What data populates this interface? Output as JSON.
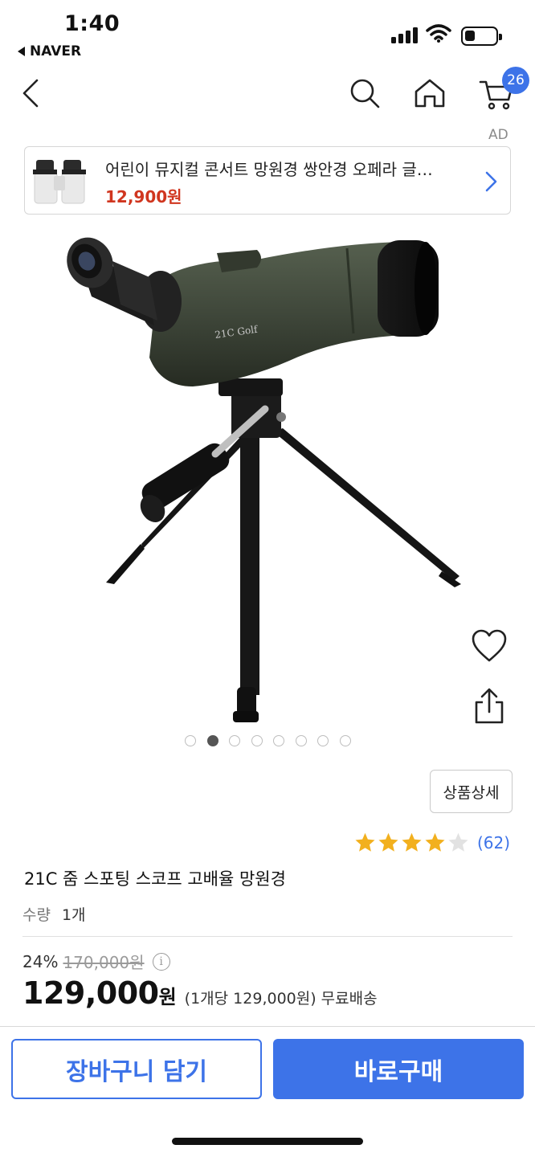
{
  "status_bar": {
    "time": "1:40",
    "back_app": "NAVER"
  },
  "nav": {
    "cart_count": "26",
    "icons": [
      "back-chevron-icon",
      "search-icon",
      "home-icon",
      "cart-icon"
    ]
  },
  "ad": {
    "label": "AD",
    "title": "어린이 뮤지컬 콘서트 망원경 쌍안경 오페라 글…",
    "price": "12,900원"
  },
  "gallery": {
    "total_images": 8,
    "active_index": 1
  },
  "product": {
    "detail_button": "상품상세",
    "rating": 4,
    "rating_max": 5,
    "review_count": "(62)",
    "title": "21C 줌 스포팅 스코프 고배율 망원경",
    "qty_label": "수량",
    "qty_value": "1개",
    "discount_pct": "24%",
    "original_price": "170,000원",
    "price": "129,000",
    "price_unit": "원",
    "price_extra": "(1개당 129,000원) 무료배송"
  },
  "actions": {
    "cart_label": "장바구니 담기",
    "buy_label": "바로구매"
  },
  "colors": {
    "accent": "#3d73e8",
    "sale_red": "#d0361f",
    "star": "#f2b01e"
  }
}
